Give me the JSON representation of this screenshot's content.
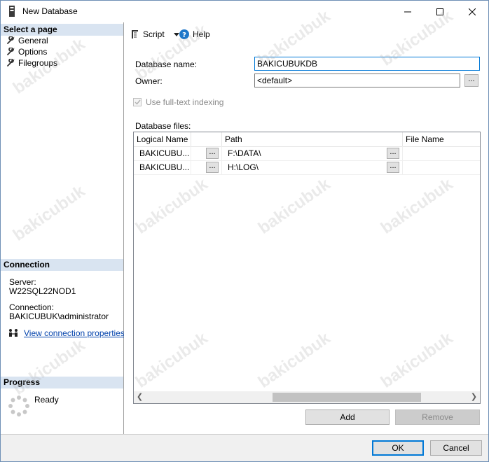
{
  "window": {
    "title": "New Database"
  },
  "sidebar": {
    "select_page_header": "Select a page",
    "pages": [
      {
        "label": "General",
        "icon": "wrench-icon"
      },
      {
        "label": "Options",
        "icon": "wrench-icon"
      },
      {
        "label": "Filegroups",
        "icon": "wrench-icon"
      }
    ],
    "connection_header": "Connection",
    "server_label": "Server:",
    "server_value": "W22SQL22NOD1",
    "connection_label": "Connection:",
    "connection_value": "BAKICUBUK\\administrator",
    "view_connection_link": "View connection properties",
    "progress_header": "Progress",
    "progress_status": "Ready"
  },
  "toolbar": {
    "script_label": "Script",
    "help_label": "Help"
  },
  "form": {
    "database_name_label": "Database name:",
    "database_name_value": "BAKICUBUKDB",
    "owner_label": "Owner:",
    "owner_value": "<default>",
    "fulltext_label": "Use full-text indexing",
    "database_files_label": "Database files:"
  },
  "grid": {
    "columns": [
      "Logical Name",
      "",
      "Path",
      "File Name"
    ],
    "rows": [
      {
        "logical_name": "BAKICUBU...",
        "path": "F:\\DATA\\",
        "file_name": ""
      },
      {
        "logical_name": "BAKICUBU...",
        "path": "H:\\LOG\\",
        "file_name": ""
      }
    ],
    "ellipsis": "..."
  },
  "buttons": {
    "add": "Add",
    "remove": "Remove",
    "ok": "OK",
    "cancel": "Cancel",
    "owner_browse": "..."
  },
  "watermark_text": "bakicubuk",
  "colors": {
    "header_band": "#d9e4f1",
    "focus_border": "#0078d7",
    "link": "#0645ad"
  }
}
